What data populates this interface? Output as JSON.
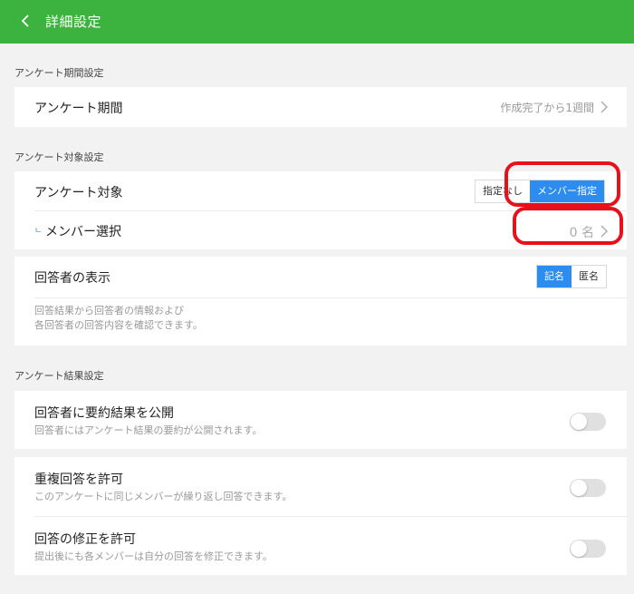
{
  "header": {
    "title": "詳細設定"
  },
  "period_section": {
    "label": "アンケート期間設定",
    "period_row": {
      "title": "アンケート期間",
      "value": "作成完了から1週間"
    }
  },
  "target_section": {
    "label": "アンケート対象設定",
    "target_row": {
      "title": "アンケート対象",
      "options": [
        "指定なし",
        "メンバー指定"
      ],
      "selected": "メンバー指定"
    },
    "member_row": {
      "marker": "ㄴ",
      "title": "メンバー選択",
      "value": "0 名"
    },
    "display_row": {
      "title": "回答者の表示",
      "options": [
        "記名",
        "匿名"
      ],
      "selected": "記名",
      "desc_line1": "回答結果から回答者の情報および",
      "desc_line2": "各回答者の回答内容を確認できます。"
    }
  },
  "result_section": {
    "label": "アンケート結果設定",
    "publish_row": {
      "title": "回答者に要約結果を公開",
      "desc": "回答者にはアンケート結果の要約が公開されます。",
      "enabled": false
    },
    "duplicate_row": {
      "title": "重複回答を許可",
      "desc": "このアンケートに同じメンバーが繰り返し回答できます。",
      "enabled": false
    },
    "edit_row": {
      "title": "回答の修正を許可",
      "desc": "提出後にも各メンバーは自分の回答を修正できます。",
      "enabled": false
    }
  },
  "colors": {
    "header": "#3db33f",
    "accent": "#2d8cf0",
    "annotation": "#e8101a"
  }
}
